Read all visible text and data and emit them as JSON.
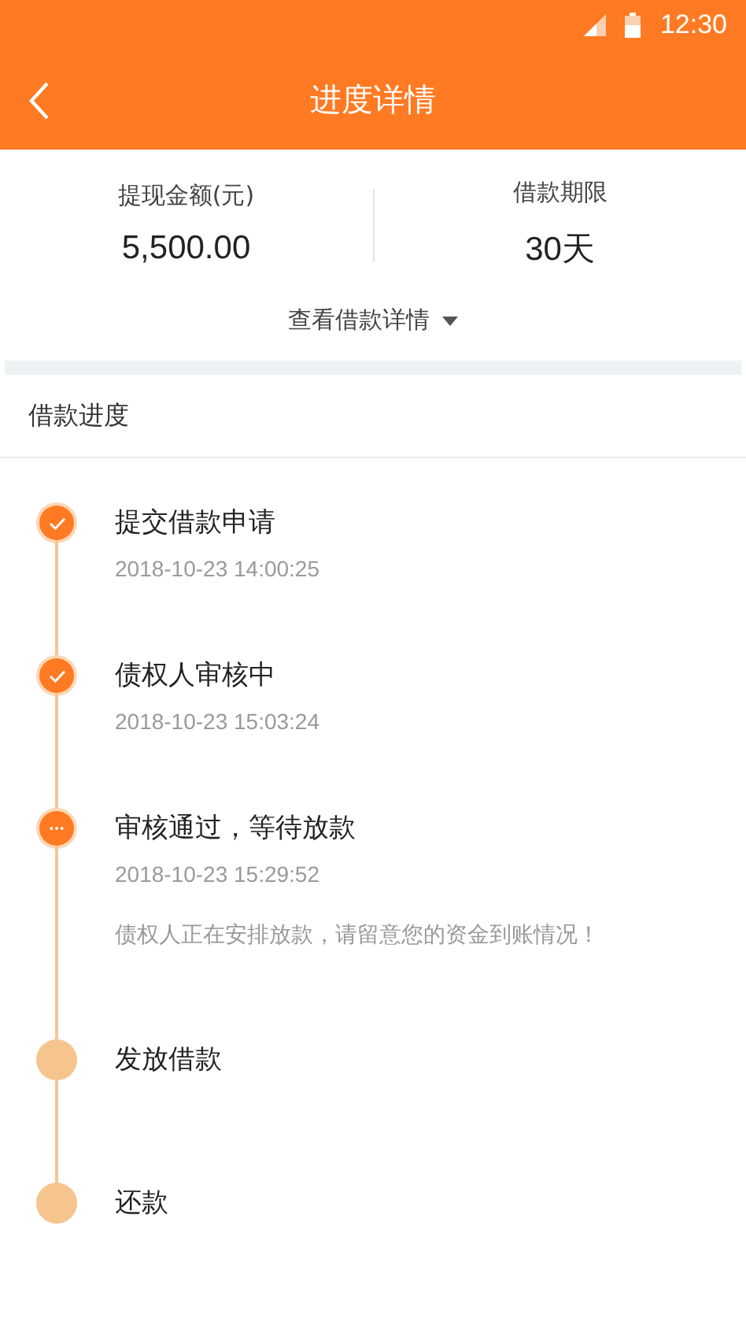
{
  "status_bar": {
    "time": "12:30"
  },
  "nav": {
    "title": "进度详情"
  },
  "summary": [
    {
      "label": "提现金额(元)",
      "value": "5,500.00"
    },
    {
      "label": "借款期限",
      "value": "30天"
    }
  ],
  "details_link": "查看借款详情",
  "progress": {
    "title": "借款进度",
    "steps": [
      {
        "kind": "done",
        "title": "提交借款申请",
        "time": "2018-10-23  14:00:25"
      },
      {
        "kind": "done",
        "title": "债权人审核中",
        "time": "2018-10-23  15:03:24"
      },
      {
        "kind": "current",
        "title": "审核通过，等待放款",
        "time": "2018-10-23  15:29:52",
        "note": "债权人正在安排放款，请留意您的资金到账情况！"
      },
      {
        "kind": "pending",
        "title": "发放借款"
      },
      {
        "kind": "pending",
        "title": "还款"
      }
    ]
  }
}
